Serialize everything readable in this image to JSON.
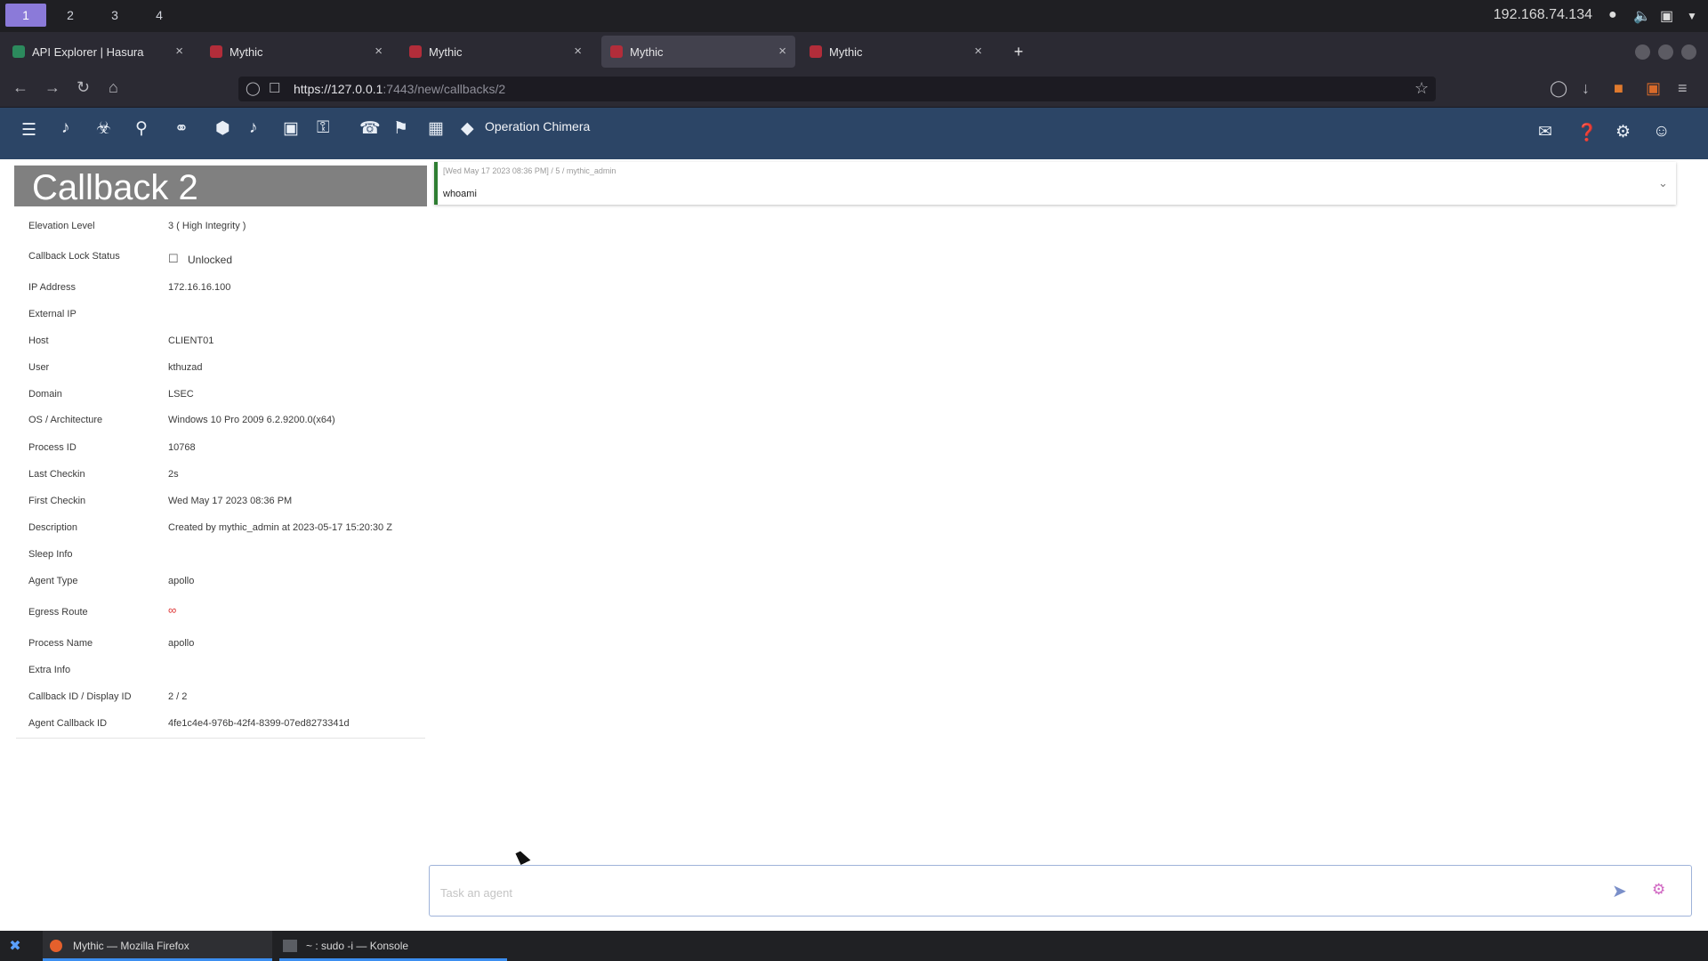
{
  "desktop": {
    "workspaces": [
      "1",
      "2",
      "3",
      "4"
    ],
    "ip": "192.168.74.134"
  },
  "browser": {
    "tabs": [
      {
        "title": "API Explorer | Hasura",
        "active": false
      },
      {
        "title": "Mythic",
        "active": false
      },
      {
        "title": "Mythic",
        "active": false
      },
      {
        "title": "Mythic",
        "active": true
      },
      {
        "title": "Mythic",
        "active": false
      }
    ],
    "url_host": "https://127.0.0.1",
    "url_path": ":7443/new/callbacks/2"
  },
  "appbar": {
    "operation": "Operation Chimera"
  },
  "callback": {
    "title": "Callback 2",
    "rows": [
      {
        "label": "Elevation Level",
        "value": "3 ( High Integrity )"
      },
      {
        "label": "Callback Lock Status",
        "value": "Unlocked"
      },
      {
        "label": "IP Address",
        "value": "172.16.16.100"
      },
      {
        "label": "External IP",
        "value": ""
      },
      {
        "label": "Host",
        "value": "CLIENT01"
      },
      {
        "label": "User",
        "value": "kthuzad"
      },
      {
        "label": "Domain",
        "value": "LSEC"
      },
      {
        "label": "OS / Architecture",
        "value": "Windows 10 Pro 2009 6.2.9200.0(x64)"
      },
      {
        "label": "Process ID",
        "value": "10768"
      },
      {
        "label": "Last Checkin",
        "value": "2s"
      },
      {
        "label": "First Checkin",
        "value": "Wed May 17 2023 08:36 PM"
      },
      {
        "label": "Description",
        "value": "Created by mythic_admin at 2023-05-17 15:20:30 Z"
      },
      {
        "label": "Sleep Info",
        "value": ""
      },
      {
        "label": "Agent Type",
        "value": "apollo"
      },
      {
        "label": "Egress Route",
        "value": ""
      },
      {
        "label": "Process Name",
        "value": "apollo"
      },
      {
        "label": "Extra Info",
        "value": ""
      },
      {
        "label": "Callback ID / Display ID",
        "value": "2 / 2"
      },
      {
        "label": "Agent Callback ID",
        "value": "4fe1c4e4-976b-42f4-8399-07ed8273341d"
      }
    ]
  },
  "task": {
    "meta": "[Wed May 17 2023 08:36 PM] / 5 / mythic_admin",
    "command": "whoami"
  },
  "taskinput": {
    "placeholder": "Task an agent"
  },
  "taskbar": {
    "items": [
      {
        "label": "Mythic — Mozilla Firefox"
      },
      {
        "label": "~ : sudo -i — Konsole"
      }
    ]
  },
  "colors": {
    "appbar": "#2c4566",
    "callback_header": "#808080",
    "task_border": "#2e7d32",
    "workspace_active": "#8b7ad9"
  }
}
